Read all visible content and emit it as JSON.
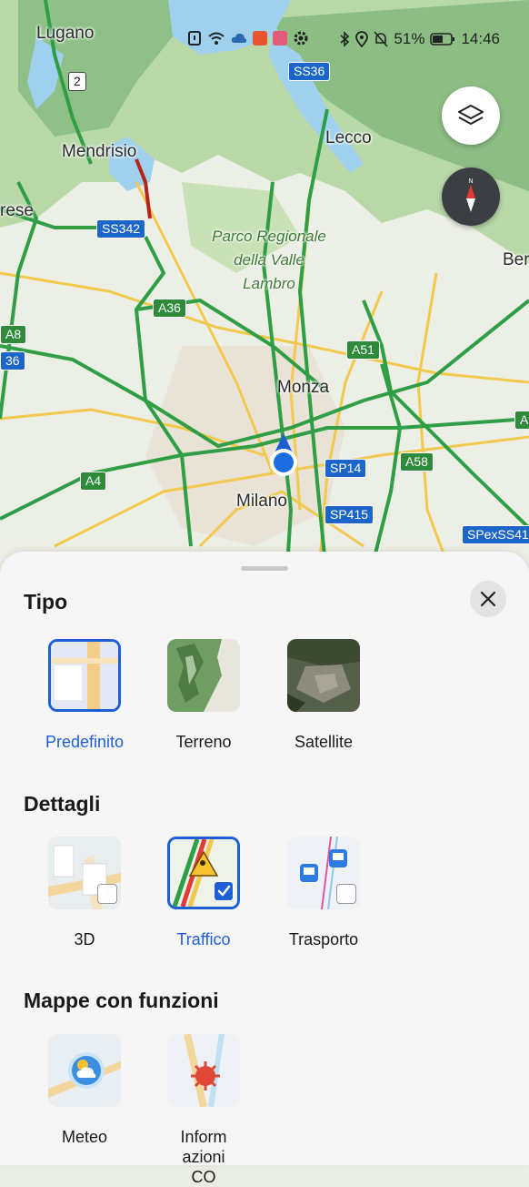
{
  "status_bar": {
    "battery": "51%",
    "time": "14:46"
  },
  "map": {
    "places": {
      "lugano": "Lugano",
      "mendrisio": "Mendrisio",
      "lecco": "Lecco",
      "varese": "rese",
      "bergamo": "Ber",
      "monza": "Monza",
      "milano": "Milano",
      "park_line1": "Parco Regionale",
      "park_line2": "della Valle",
      "park_line3": "Lambro"
    },
    "shields": {
      "n2": "2",
      "ss36": "SS36",
      "ss342": "SS342",
      "a36": "A36",
      "a8": "A8",
      "a36_left": "36",
      "a51": "A51",
      "a4": "A4",
      "sp14": "SP14",
      "a58": "A58",
      "sp415": "SP415",
      "spexss41": "SPexSS41",
      "a_right": "A"
    }
  },
  "sheet": {
    "tipo": {
      "title": "Tipo",
      "options": [
        "Predefinito",
        "Terreno",
        "Satellite"
      ],
      "selected": "Predefinito"
    },
    "dettagli": {
      "title": "Dettagli",
      "options": [
        "3D",
        "Traffico",
        "Trasporto"
      ],
      "checked": [
        "Traffico"
      ]
    },
    "funzioni": {
      "title": "Mappe con funzioni",
      "options": [
        "Meteo",
        "Inform azioni CO"
      ]
    }
  },
  "colors": {
    "accent": "#1f5fd6",
    "highway": "#2f9e44",
    "road_yellow": "#f2c94c",
    "water": "#9fd0ee"
  }
}
